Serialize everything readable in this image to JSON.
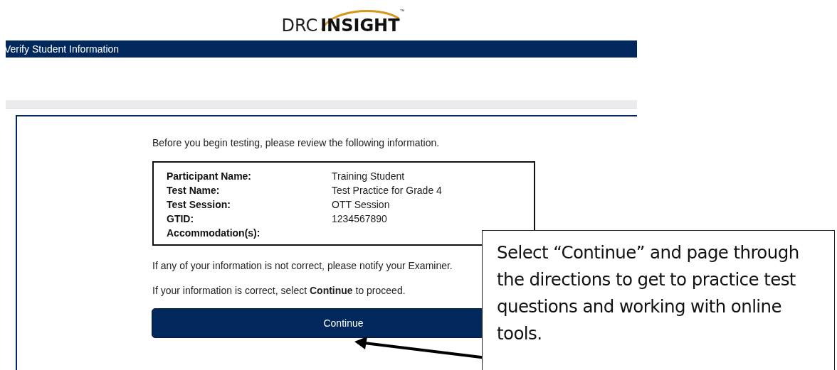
{
  "logo": {
    "prefix": "DRC",
    "name": "INSIGHT",
    "mark": "™"
  },
  "header": {
    "title": "Verify Student Information"
  },
  "intro": "Before you begin testing, please review the following information.",
  "info_rows": [
    {
      "label": "Participant Name:",
      "value": "Training Student"
    },
    {
      "label": "Test Name:",
      "value": "Test Practice for Grade 4"
    },
    {
      "label": "Test Session:",
      "value": "OTT Session"
    },
    {
      "label": "GTID:",
      "value": "1234567890"
    },
    {
      "label": "Accommodation(s):"
    }
  ],
  "notice": "If any of your information is not correct, please notify your Examiner.",
  "proceed": "If your information is correct, select **Continue** to proceed.",
  "continue_button": "Continue",
  "callout": {
    "text": "Select “Continue” and page through the directions to get to practice test questions and working with online tools."
  }
}
